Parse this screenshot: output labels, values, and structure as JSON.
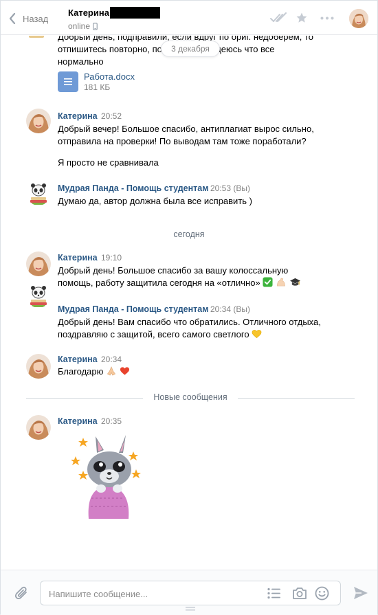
{
  "header": {
    "back_label": "Назад",
    "peer_name": "Катерина",
    "peer_status": "online"
  },
  "chat": {
    "top_message": {
      "lines": [
        "Добрый день, подправили, если вдруг по ориг. недоберем, то",
        "отпишитесь повторно, пожалуйста, надеюсь что все",
        "нормально"
      ],
      "date_pill": "3 декабря",
      "attachment": {
        "name": "Работа.docx",
        "size": "181 КБ"
      }
    },
    "messages": [
      {
        "author": "Катерина",
        "time": "20:52",
        "lines": [
          "Добрый вечер! Большое спасибо, антиплагиат вырос сильно,",
          "отправила на проверки! По выводам там тоже поработали?"
        ],
        "extra": "Я просто не сравнивала"
      },
      {
        "author": "Мудрая Панда - Помощь студентам",
        "time": "20:53 (Вы)",
        "lines": [
          "Думаю да, автор должна была все исправить )"
        ]
      },
      {
        "author": "Катерина",
        "time": "19:10",
        "lines": [
          "Добрый день! Большое спасибо за вашу колоссальную",
          "помощь, работу защитила сегодня на «отлично»"
        ]
      },
      {
        "author": "Мудрая Панда - Помощь студентам",
        "time": "20:34 (Вы)",
        "lines": [
          "Добрый день! Вам спасибо что обратились. Отличного отдыха,",
          "поздравляю с защитой, всего самого светлого"
        ]
      },
      {
        "author": "Катерина",
        "time": "20:34",
        "lines": [
          "Благодарю"
        ]
      },
      {
        "author": "Катерина",
        "time": "20:35"
      }
    ],
    "day_separator": "сегодня",
    "new_messages_label": "Новые сообщения"
  },
  "composer": {
    "placeholder": "Напишите сообщение..."
  },
  "icons": {
    "back": "chevron-left-icon",
    "read": "double-check-icon",
    "favorite": "star-icon",
    "more": "ellipsis-icon",
    "attach": "paperclip-icon",
    "templates": "list-icon",
    "camera": "camera-icon",
    "emoji": "smile-icon",
    "send": "send-icon"
  },
  "colors": {
    "author": "#2a5885",
    "muted": "#828282",
    "doc_icon": "#6f9ad6",
    "check_emoji": "#3cb43c",
    "heart": "#e8432d"
  }
}
